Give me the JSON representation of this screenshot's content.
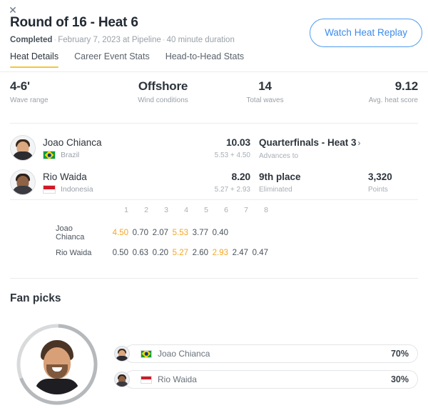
{
  "window": {
    "close_label": "✕"
  },
  "header": {
    "title": "Round of 16 - Heat 6",
    "status": "Completed",
    "sep1": "·",
    "meta1": "February 7, 2023 at Pipeline",
    "sep2": "·",
    "meta2": "40 minute duration",
    "replay_button": "Watch Heat Replay"
  },
  "tabs": [
    {
      "label": "Heat Details",
      "active": true
    },
    {
      "label": "Career Event Stats",
      "active": false
    },
    {
      "label": "Head-to-Head Stats",
      "active": false
    }
  ],
  "conditions": [
    {
      "value": "4-6'",
      "label": "Wave range"
    },
    {
      "value": "Offshore",
      "label": "Wind conditions"
    },
    {
      "value": "14",
      "label": "Total waves"
    },
    {
      "value": "9.12",
      "label": "Avg. heat score"
    }
  ],
  "athletes": [
    {
      "name": "Joao Chianca",
      "country": "Brazil",
      "flag": "br",
      "score": "10.03",
      "score_breakdown": "5.53 + 4.50",
      "result": "Quarterfinals - Heat 3",
      "result_chevron": "›",
      "result_sub": "Advances to",
      "points": "",
      "points_label": ""
    },
    {
      "name": "Rio Waida",
      "country": "Indonesia",
      "flag": "id",
      "score": "8.20",
      "score_breakdown": "5.27 + 2.93",
      "result": "9th place",
      "result_chevron": "",
      "result_sub": "Eliminated",
      "points": "3,320",
      "points_label": "Points"
    }
  ],
  "wave_table": {
    "columns": [
      "1",
      "2",
      "3",
      "4",
      "5",
      "6",
      "7",
      "8"
    ],
    "rows": [
      {
        "label": "Joao Chianca",
        "scores": [
          "4.50",
          "0.70",
          "2.07",
          "5.53",
          "3.77",
          "0.40",
          "",
          ""
        ],
        "highlight": [
          true,
          false,
          false,
          true,
          false,
          false,
          false,
          false
        ]
      },
      {
        "label": "Rio Waida",
        "scores": [
          "0.50",
          "0.63",
          "0.20",
          "5.27",
          "2.60",
          "2.93",
          "2.47",
          "0.47"
        ],
        "highlight": [
          false,
          false,
          false,
          true,
          false,
          true,
          false,
          false
        ]
      }
    ]
  },
  "fan_picks": {
    "title": "Fan picks",
    "leader_share": 70,
    "rows": [
      {
        "name": "Joao Chianca",
        "flag": "br",
        "percent": "70%",
        "value": 70
      },
      {
        "name": "Rio Waida",
        "flag": "id",
        "percent": "30%",
        "value": 30
      }
    ]
  },
  "colors": {
    "accent_blue": "#3b8ced",
    "tab_underline": "#f3c63f",
    "highlight_orange": "#f5a623",
    "text_primary": "#2d343c",
    "text_muted": "#9aa1a9",
    "divider": "#ececec",
    "ring_major": "#b6b9bc",
    "ring_minor": "#d8dadc"
  },
  "chart_data": {
    "type": "pie",
    "title": "Fan picks",
    "categories": [
      "Joao Chianca",
      "Rio Waida"
    ],
    "values": [
      70,
      30
    ],
    "unit": "%",
    "legend_position": "right"
  }
}
